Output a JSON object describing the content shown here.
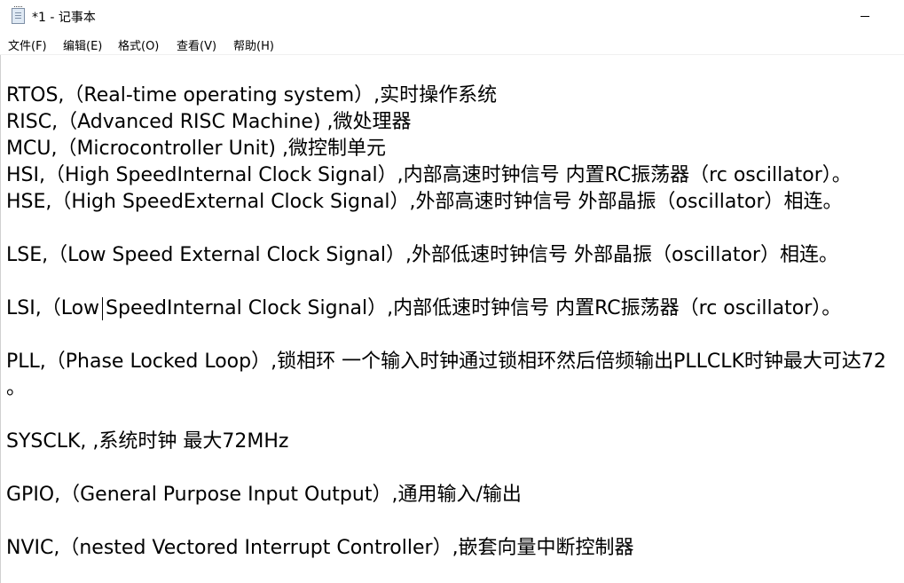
{
  "window": {
    "title": "*1 - 记事本"
  },
  "menu": [
    {
      "label": "文件(F)"
    },
    {
      "label": "编辑(E)"
    },
    {
      "label": "格式(O)"
    },
    {
      "label": "查看(V)"
    },
    {
      "label": "帮助(H)"
    }
  ],
  "editor": {
    "lines": [
      "",
      "RTOS,（Real-time operating system）,实时操作系统",
      "RISC,（Advanced RISC Machine) ,微处理器",
      "MCU,（Microcontroller Unit) ,微控制单元",
      "HSI,（High SpeedInternal Clock Signal）,内部高速时钟信号 内置RC振荡器（rc oscillator）。",
      "HSE,（High SpeedExternal Clock Signal）,外部高速时钟信号 外部晶振（oscillator）相连。",
      "",
      "LSE,（Low Speed External Clock Signal）,外部低速时钟信号 外部晶振（oscillator）相连。",
      "",
      "LSI,（Low SpeedInternal Clock Signal）,内部低速时钟信号 内置RC振荡器（rc oscillator）。",
      "",
      "PLL,（Phase Locked Loop）,锁相环 一个输入时钟通过锁相环然后倍频输出PLLCLK时钟最大可达72",
      "。",
      "",
      "SYSCLK, ,系统时钟 最大72MHz",
      "",
      "GPIO,（General Purpose Input Output）,通用输入/输出",
      "",
      "NVIC,（nested Vectored Interrupt Controller）,嵌套向量中断控制器"
    ]
  }
}
